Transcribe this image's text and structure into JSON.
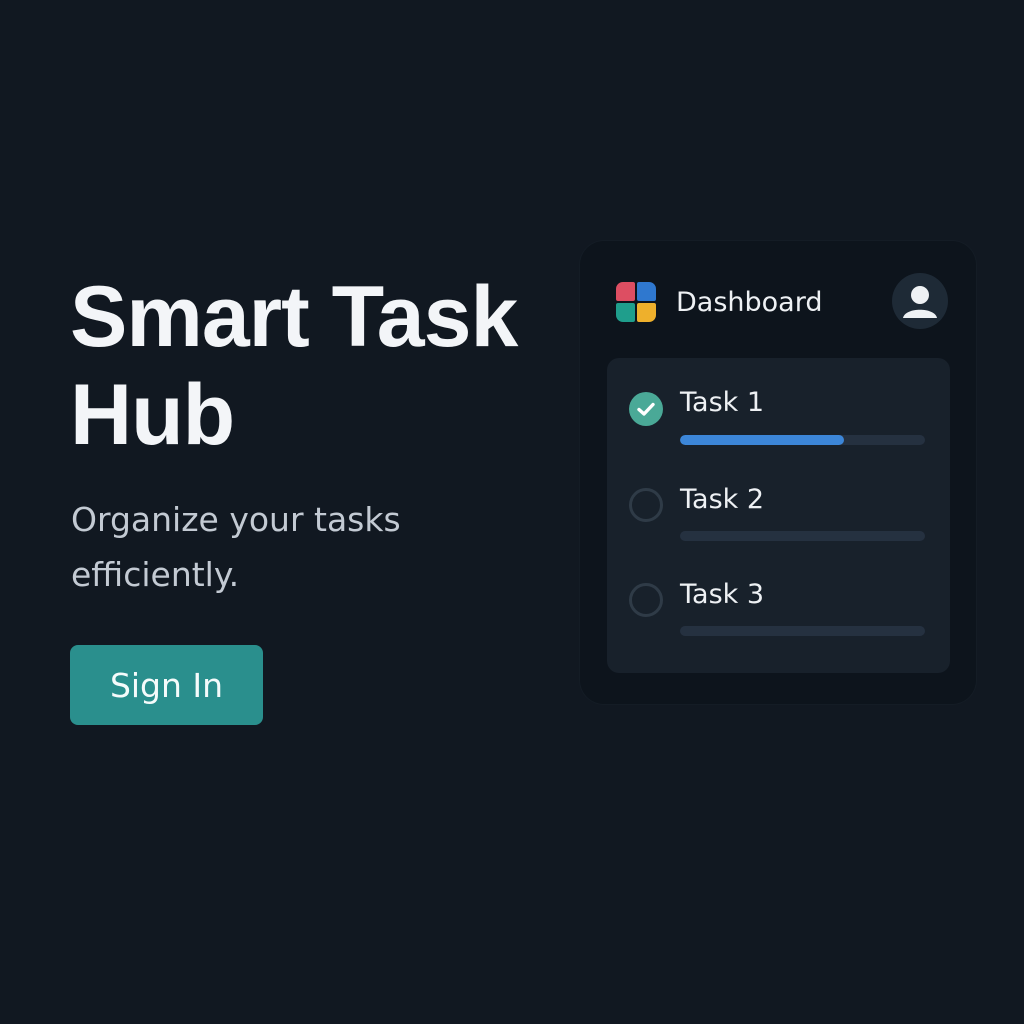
{
  "hero": {
    "title": "Smart Task Hub",
    "subtitle": "Organize your tasks efficiently.",
    "signin_label": "Sign In"
  },
  "dashboard": {
    "title": "Dashboard",
    "logo_icon": "four-square-grid-icon",
    "avatar_icon": "user-avatar-icon",
    "tasks": [
      {
        "label": "Task 1",
        "completed": true,
        "progress": 0.67
      },
      {
        "label": "Task 2",
        "completed": false,
        "progress": 0
      },
      {
        "label": "Task 3",
        "completed": false,
        "progress": 0
      }
    ]
  },
  "colors": {
    "background": "#111821",
    "accent": "#2a8f8d",
    "progress": "#3c86d8",
    "check_done": "#4aa997",
    "logo": [
      "#dd4e62",
      "#2f78cf",
      "#1f9e8c",
      "#eeb02c"
    ]
  }
}
